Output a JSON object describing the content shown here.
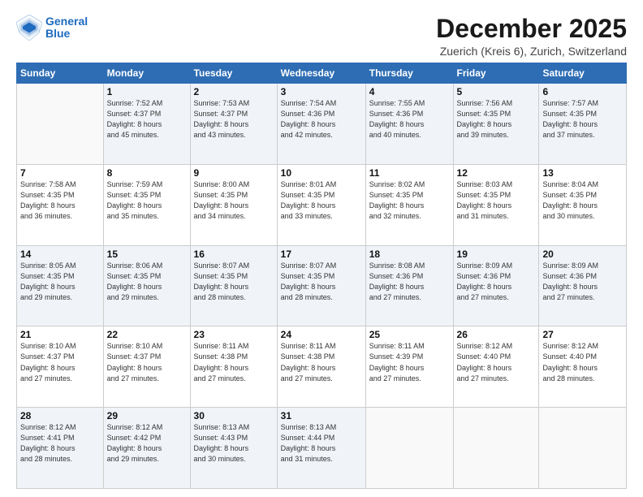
{
  "header": {
    "logo_line1": "General",
    "logo_line2": "Blue",
    "title": "December 2025",
    "subtitle": "Zuerich (Kreis 6), Zurich, Switzerland"
  },
  "calendar": {
    "days_of_week": [
      "Sunday",
      "Monday",
      "Tuesday",
      "Wednesday",
      "Thursday",
      "Friday",
      "Saturday"
    ],
    "weeks": [
      [
        {
          "day": "",
          "info": ""
        },
        {
          "day": "1",
          "info": "Sunrise: 7:52 AM\nSunset: 4:37 PM\nDaylight: 8 hours\nand 45 minutes."
        },
        {
          "day": "2",
          "info": "Sunrise: 7:53 AM\nSunset: 4:37 PM\nDaylight: 8 hours\nand 43 minutes."
        },
        {
          "day": "3",
          "info": "Sunrise: 7:54 AM\nSunset: 4:36 PM\nDaylight: 8 hours\nand 42 minutes."
        },
        {
          "day": "4",
          "info": "Sunrise: 7:55 AM\nSunset: 4:36 PM\nDaylight: 8 hours\nand 40 minutes."
        },
        {
          "day": "5",
          "info": "Sunrise: 7:56 AM\nSunset: 4:35 PM\nDaylight: 8 hours\nand 39 minutes."
        },
        {
          "day": "6",
          "info": "Sunrise: 7:57 AM\nSunset: 4:35 PM\nDaylight: 8 hours\nand 37 minutes."
        }
      ],
      [
        {
          "day": "7",
          "info": "Sunrise: 7:58 AM\nSunset: 4:35 PM\nDaylight: 8 hours\nand 36 minutes."
        },
        {
          "day": "8",
          "info": "Sunrise: 7:59 AM\nSunset: 4:35 PM\nDaylight: 8 hours\nand 35 minutes."
        },
        {
          "day": "9",
          "info": "Sunrise: 8:00 AM\nSunset: 4:35 PM\nDaylight: 8 hours\nand 34 minutes."
        },
        {
          "day": "10",
          "info": "Sunrise: 8:01 AM\nSunset: 4:35 PM\nDaylight: 8 hours\nand 33 minutes."
        },
        {
          "day": "11",
          "info": "Sunrise: 8:02 AM\nSunset: 4:35 PM\nDaylight: 8 hours\nand 32 minutes."
        },
        {
          "day": "12",
          "info": "Sunrise: 8:03 AM\nSunset: 4:35 PM\nDaylight: 8 hours\nand 31 minutes."
        },
        {
          "day": "13",
          "info": "Sunrise: 8:04 AM\nSunset: 4:35 PM\nDaylight: 8 hours\nand 30 minutes."
        }
      ],
      [
        {
          "day": "14",
          "info": "Sunrise: 8:05 AM\nSunset: 4:35 PM\nDaylight: 8 hours\nand 29 minutes."
        },
        {
          "day": "15",
          "info": "Sunrise: 8:06 AM\nSunset: 4:35 PM\nDaylight: 8 hours\nand 29 minutes."
        },
        {
          "day": "16",
          "info": "Sunrise: 8:07 AM\nSunset: 4:35 PM\nDaylight: 8 hours\nand 28 minutes."
        },
        {
          "day": "17",
          "info": "Sunrise: 8:07 AM\nSunset: 4:35 PM\nDaylight: 8 hours\nand 28 minutes."
        },
        {
          "day": "18",
          "info": "Sunrise: 8:08 AM\nSunset: 4:36 PM\nDaylight: 8 hours\nand 27 minutes."
        },
        {
          "day": "19",
          "info": "Sunrise: 8:09 AM\nSunset: 4:36 PM\nDaylight: 8 hours\nand 27 minutes."
        },
        {
          "day": "20",
          "info": "Sunrise: 8:09 AM\nSunset: 4:36 PM\nDaylight: 8 hours\nand 27 minutes."
        }
      ],
      [
        {
          "day": "21",
          "info": "Sunrise: 8:10 AM\nSunset: 4:37 PM\nDaylight: 8 hours\nand 27 minutes."
        },
        {
          "day": "22",
          "info": "Sunrise: 8:10 AM\nSunset: 4:37 PM\nDaylight: 8 hours\nand 27 minutes."
        },
        {
          "day": "23",
          "info": "Sunrise: 8:11 AM\nSunset: 4:38 PM\nDaylight: 8 hours\nand 27 minutes."
        },
        {
          "day": "24",
          "info": "Sunrise: 8:11 AM\nSunset: 4:38 PM\nDaylight: 8 hours\nand 27 minutes."
        },
        {
          "day": "25",
          "info": "Sunrise: 8:11 AM\nSunset: 4:39 PM\nDaylight: 8 hours\nand 27 minutes."
        },
        {
          "day": "26",
          "info": "Sunrise: 8:12 AM\nSunset: 4:40 PM\nDaylight: 8 hours\nand 27 minutes."
        },
        {
          "day": "27",
          "info": "Sunrise: 8:12 AM\nSunset: 4:40 PM\nDaylight: 8 hours\nand 28 minutes."
        }
      ],
      [
        {
          "day": "28",
          "info": "Sunrise: 8:12 AM\nSunset: 4:41 PM\nDaylight: 8 hours\nand 28 minutes."
        },
        {
          "day": "29",
          "info": "Sunrise: 8:12 AM\nSunset: 4:42 PM\nDaylight: 8 hours\nand 29 minutes."
        },
        {
          "day": "30",
          "info": "Sunrise: 8:13 AM\nSunset: 4:43 PM\nDaylight: 8 hours\nand 30 minutes."
        },
        {
          "day": "31",
          "info": "Sunrise: 8:13 AM\nSunset: 4:44 PM\nDaylight: 8 hours\nand 31 minutes."
        },
        {
          "day": "",
          "info": ""
        },
        {
          "day": "",
          "info": ""
        },
        {
          "day": "",
          "info": ""
        }
      ]
    ]
  }
}
